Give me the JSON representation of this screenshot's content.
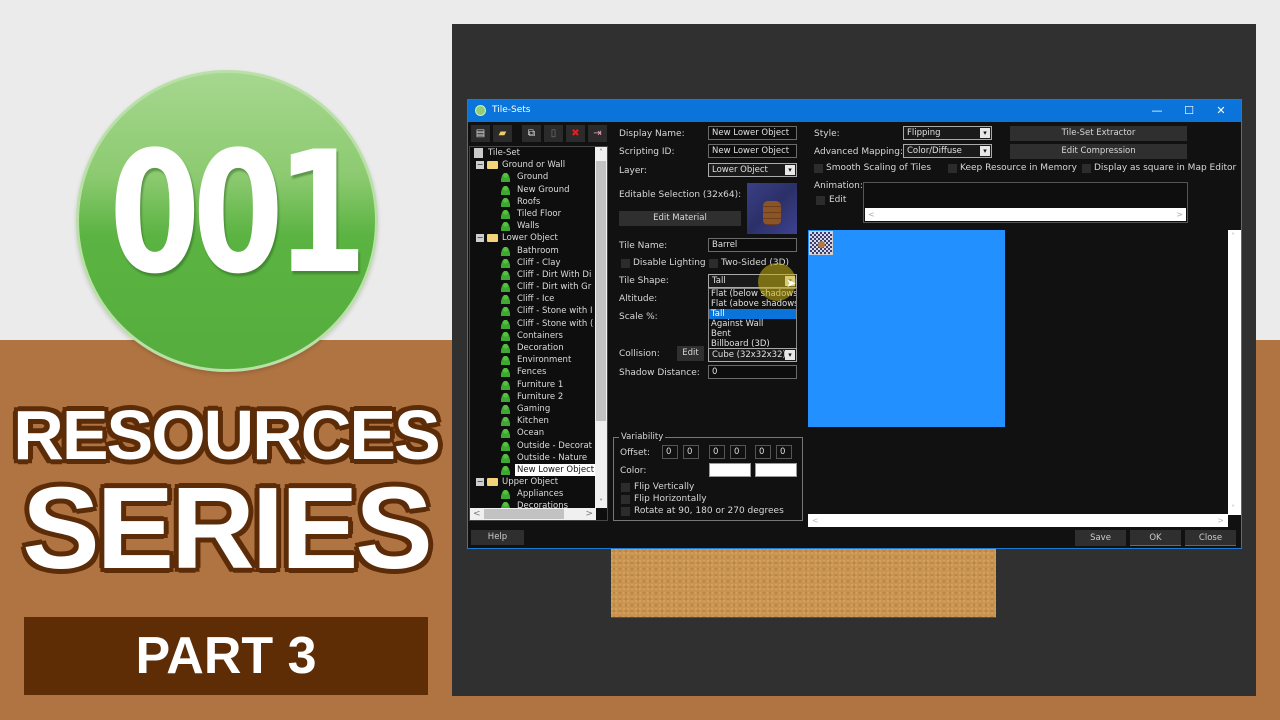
{
  "thumbnail": {
    "logo_number": "001",
    "title_line1": "RESOURCES",
    "title_line2": "SERIES",
    "part_label": "PART 3",
    "colors": {
      "green": "#5bb342",
      "brown_bg": "#b07442",
      "dark_brown": "#5e2c05"
    }
  },
  "window": {
    "title": "Tile-Sets",
    "controls": {
      "minimize": "—",
      "maximize": "☐",
      "close": "✕"
    },
    "accent": "#0a74da"
  },
  "toolbar": {
    "buttons": [
      {
        "name": "new-icon",
        "glyph": "▤"
      },
      {
        "name": "open-folder-icon",
        "glyph": "▰"
      },
      {
        "name": "copy-icon",
        "glyph": "⧉"
      },
      {
        "name": "paste-icon",
        "glyph": "▯"
      },
      {
        "name": "delete-icon",
        "glyph": "✖"
      },
      {
        "name": "export-icon",
        "glyph": "⇥"
      }
    ]
  },
  "tree": {
    "root": "Tile-Set",
    "groups": [
      {
        "label": "Ground or Wall",
        "expanded": true,
        "items": [
          "Ground",
          "New Ground",
          "Roofs",
          "Tiled Floor",
          "Walls"
        ]
      },
      {
        "label": "Lower Object",
        "expanded": true,
        "items": [
          "Bathroom",
          "Cliff - Clay",
          "Cliff - Dirt With Di",
          "Cliff - Dirt with Gr",
          "Cliff - Ice",
          "Cliff - Stone with I",
          "Cliff - Stone with (",
          "Containers",
          "Decoration",
          "Environment",
          "Fences",
          "Furniture 1",
          "Furniture 2",
          "Gaming",
          "Kitchen",
          "Ocean",
          "Outside - Decorat",
          "Outside - Nature",
          "New Lower Object"
        ]
      },
      {
        "label": "Upper Object",
        "expanded": true,
        "items": [
          "Appliances",
          "Decorations"
        ]
      }
    ],
    "selected": "New Lower Object",
    "expand_glyph": "−",
    "scroll": {
      "up": "˄",
      "down": "˅",
      "left": "<",
      "right": ">"
    }
  },
  "form": {
    "display_name_label": "Display Name:",
    "display_name_value": "New Lower Object",
    "scripting_id_label": "Scripting ID:",
    "scripting_id_value": "New Lower Object",
    "layer_label": "Layer:",
    "layer_value": "Lower Object",
    "editable_selection_label": "Editable Selection (32x64):",
    "edit_material_button": "Edit Material",
    "tile_name_label": "Tile Name:",
    "tile_name_value": "Barrel",
    "disable_lighting_label": "Disable Lighting",
    "two_sided_label": "Two-Sided (3D)",
    "tile_shape_label": "Tile Shape:",
    "tile_shape_value": "Tall",
    "tile_shape_options": [
      "Flat (below shadows)",
      "Flat (above shadows)",
      "Tall",
      "Against Wall",
      "Bent",
      "Billboard (3D)"
    ],
    "altitude_label": "Altitude:",
    "scale_label": "Scale %:",
    "collision_label": "Collision:",
    "collision_edit_button": "Edit",
    "collision_value": "Cube (32x32x32)",
    "shadow_distance_label": "Shadow Distance:",
    "shadow_distance_value": "0",
    "caret": "▾"
  },
  "variability": {
    "title": "Variability",
    "offset_label": "Offset:",
    "offsets": [
      "0",
      "0",
      "0",
      "0",
      "0",
      "0"
    ],
    "color_label": "Color:",
    "flip_vertically": "Flip Vertically",
    "flip_horizontally": "Flip Horizontally",
    "rotate": "Rotate at 90, 180 or 270 degrees"
  },
  "right": {
    "style_label": "Style:",
    "style_value": "Flipping",
    "advanced_mapping_label": "Advanced Mapping:",
    "advanced_mapping_value": "Color/Diffuse",
    "tileset_extractor_button": "Tile-Set Extractor",
    "edit_compression_button": "Edit Compression",
    "smooth_scaling_label": "Smooth Scaling of Tiles",
    "keep_resource_label": "Keep Resource in Memory",
    "display_square_label": "Display as square in Map Editor",
    "animation_label": "Animation:",
    "animation_edit_label": "Edit"
  },
  "footer": {
    "help": "Help",
    "save": "Save",
    "ok": "OK",
    "close": "Close"
  }
}
